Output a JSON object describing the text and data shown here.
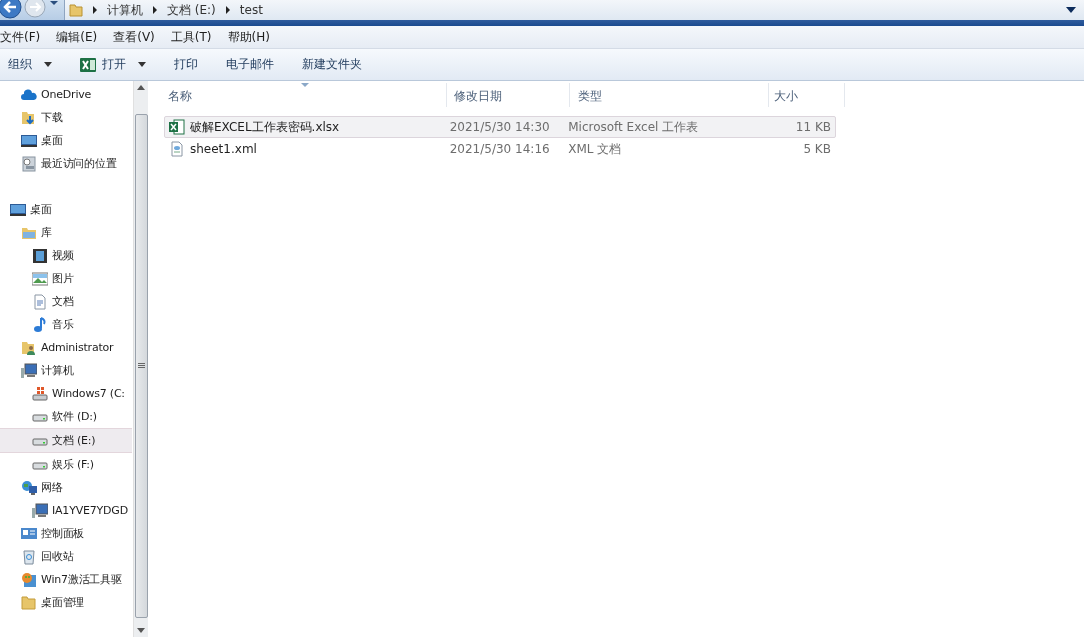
{
  "address_bar": {
    "crumbs": [
      "计算机",
      "文档 (E:)",
      "test"
    ]
  },
  "menu_bar": [
    "文件(F)",
    "编辑(E)",
    "查看(V)",
    "工具(T)",
    "帮助(H)"
  ],
  "toolbar": [
    {
      "label": "组织",
      "kind": "dropdown"
    },
    {
      "label": "打开",
      "kind": "excel-dropdown"
    },
    {
      "label": "打印",
      "kind": "plain"
    },
    {
      "label": "电子邮件",
      "kind": "plain"
    },
    {
      "label": "新建文件夹",
      "kind": "plain"
    }
  ],
  "favorites": [
    {
      "label": "OneDrive",
      "kind": "cloud",
      "selected": false
    },
    {
      "label": "下载",
      "kind": "download",
      "selected": false
    },
    {
      "label": "桌面",
      "kind": "desktop",
      "selected": false
    },
    {
      "label": "最近访问的位置",
      "kind": "recent",
      "selected": false
    }
  ],
  "tree": [
    {
      "label": "桌面",
      "kind": "desktop",
      "selected": false,
      "children": [
        {
          "label": "库",
          "kind": "library",
          "selected": false,
          "children": [
            {
              "label": "视频",
              "kind": "video",
              "selected": false
            },
            {
              "label": "图片",
              "kind": "image",
              "selected": false
            },
            {
              "label": "文档",
              "kind": "document",
              "selected": false
            },
            {
              "label": "音乐",
              "kind": "music",
              "selected": false
            }
          ]
        },
        {
          "label": "Administrator",
          "kind": "user",
          "selected": false
        },
        {
          "label": "计算机",
          "kind": "computer",
          "selected": false,
          "children": [
            {
              "label": "Windows7 (C:",
              "kind": "system-drive",
              "selected": false
            },
            {
              "label": "软件 (D:)",
              "kind": "drive",
              "selected": false
            },
            {
              "label": "文档 (E:)",
              "kind": "drive",
              "selected": true
            },
            {
              "label": "娱乐 (F:)",
              "kind": "drive",
              "selected": false
            }
          ]
        },
        {
          "label": "网络",
          "kind": "network",
          "selected": false,
          "children": [
            {
              "label": "IA1YVE7YDGD",
              "kind": "pc",
              "selected": false
            }
          ]
        },
        {
          "label": "控制面板",
          "kind": "control-panel",
          "selected": false
        },
        {
          "label": "回收站",
          "kind": "recycle",
          "selected": false
        },
        {
          "label": "Win7激活工具驱",
          "kind": "app",
          "selected": false
        },
        {
          "label": "桌面管理",
          "kind": "folder",
          "selected": false
        }
      ]
    }
  ],
  "file_list": {
    "columns": [
      "名称",
      "修改日期",
      "类型",
      "大小"
    ],
    "rows": [
      {
        "name": "破解EXCEL工作表密码.xlsx",
        "modified": "2021/5/30 14:30",
        "type": "Microsoft Excel 工作表",
        "size": "11 KB",
        "kind": "excel",
        "selected": true
      },
      {
        "name": "sheet1.xml",
        "modified": "2021/5/30 14:16",
        "type": "XML 文档",
        "size": "5 KB",
        "kind": "xml",
        "selected": false
      }
    ]
  }
}
